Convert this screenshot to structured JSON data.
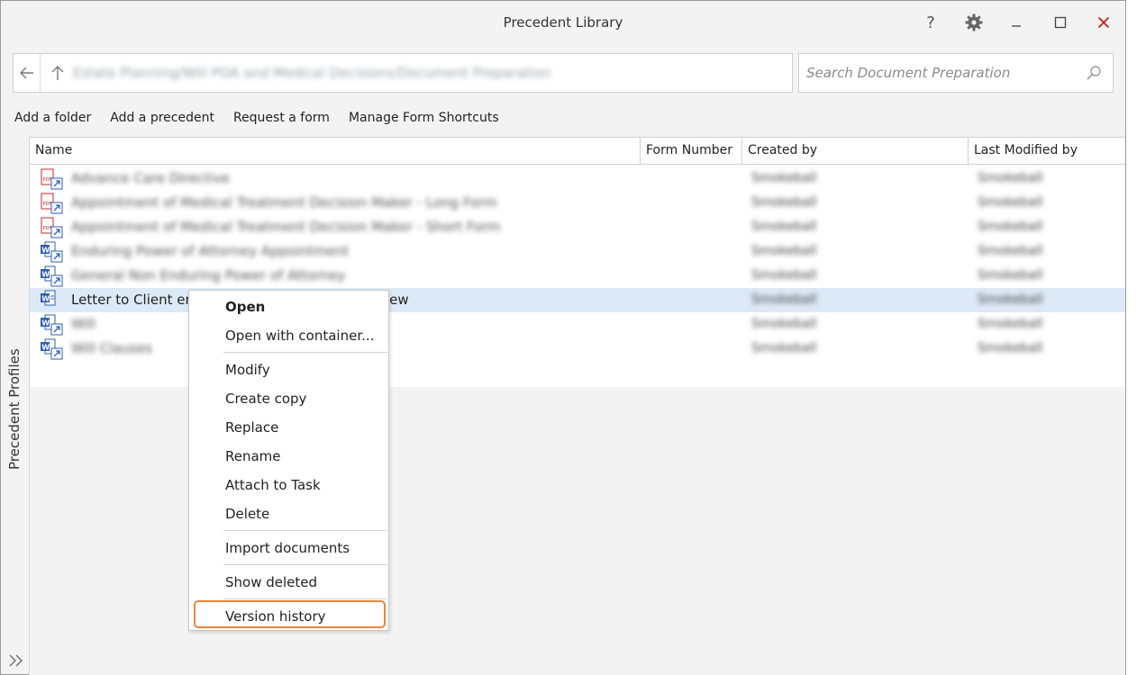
{
  "window": {
    "title": "Precedent Library"
  },
  "titlebar": {
    "help": "?",
    "minimize": "_",
    "maximize": "□",
    "close": "✕"
  },
  "address": {
    "path": "Estate Planning/Will POA and Medical Decisions/Document Preparation"
  },
  "search": {
    "placeholder": "Search Document Preparation"
  },
  "toolbar": {
    "add_folder": "Add a folder",
    "add_precedent": "Add a precedent",
    "request_form": "Request a form",
    "manage_shortcuts": "Manage Form Shortcuts"
  },
  "sidepanel": {
    "label": "Precedent Profiles"
  },
  "columns": {
    "name": "Name",
    "form_number": "Form Number",
    "created_by": "Created by",
    "last_modified_by": "Last Modified by"
  },
  "rows": [
    {
      "icon": "pdf-shortcut-icon",
      "name": "Advance Care Directive",
      "created_by": "Smokeball",
      "modified_by": "Smokeball",
      "blurred": true
    },
    {
      "icon": "pdf-shortcut-icon",
      "name": "Appointment of Medical Treatment Decision Maker - Long Form",
      "created_by": "Smokeball",
      "modified_by": "Smokeball",
      "blurred": true
    },
    {
      "icon": "pdf-shortcut-icon",
      "name": "Appointment of Medical Treatment Decision Maker - Short Form",
      "created_by": "Smokeball",
      "modified_by": "Smokeball",
      "blurred": true
    },
    {
      "icon": "word-shortcut-icon",
      "name": "Enduring Power of Attorney Appointment",
      "created_by": "Smokeball",
      "modified_by": "Smokeball",
      "blurred": true
    },
    {
      "icon": "word-shortcut-icon",
      "name": "General Non Enduring Power of Attorney",
      "created_by": "Smokeball",
      "modified_by": "Smokeball",
      "blurred": true
    },
    {
      "icon": "word-icon",
      "name": "Letter to Client enc",
      "name_tail": "iew",
      "created_by": "Smokeball",
      "modified_by": "Smokeball",
      "blurred": false,
      "selected": true
    },
    {
      "icon": "word-shortcut-icon",
      "name": "Will",
      "created_by": "Smokeball",
      "modified_by": "Smokeball",
      "blurred": true
    },
    {
      "icon": "word-shortcut-icon",
      "name": "Will Clauses",
      "created_by": "Smokeball",
      "modified_by": "Smokeball",
      "blurred": true
    }
  ],
  "context_menu": {
    "open": "Open",
    "open_container": "Open with container...",
    "modify": "Modify",
    "create_copy": "Create copy",
    "replace": "Replace",
    "rename": "Rename",
    "attach_task": "Attach to Task",
    "delete": "Delete",
    "import_documents": "Import documents",
    "show_deleted": "Show deleted",
    "version_history": "Version history"
  },
  "colors": {
    "accent_highlight": "#e8853a",
    "selected_row": "#dde9f6",
    "close": "#d11b1b",
    "pdf": "#d32f2f",
    "word": "#2b5fb4"
  }
}
